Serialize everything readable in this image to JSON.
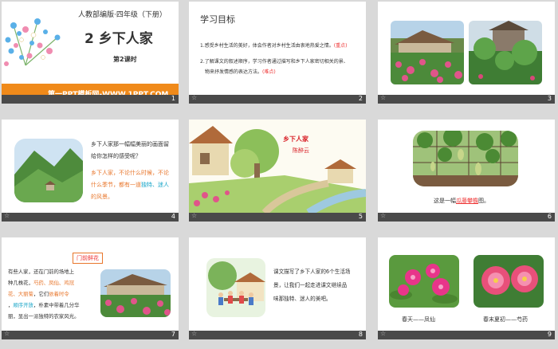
{
  "slides": [
    {
      "num": "1",
      "publisher": "人教部编版·四年级（下册）",
      "lesson_title": "2 乡下人家",
      "period": "第2课时",
      "footer": "第一PPT模板网-WWW.1PPT.COM"
    },
    {
      "num": "2",
      "heading": "学习目标",
      "goal1": "1.感受乡村生活的美好，体会作者对乡村生活由衷地热爱之情。",
      "goal1_tag": "(重点)",
      "goal2a": "2.了解课文的叙述顺序，学习作者通过描写和乡下人家密切相关的景、",
      "goal2b": "物来抒发情感的表达方法。",
      "goal2_tag": "(难点)"
    },
    {
      "num": "3"
    },
    {
      "num": "4",
      "question_a": "乡下人家那一幅幅美丽的画面留",
      "question_b": "给你怎样的感受呢？",
      "answer_a": "乡下人家，不论什么时候，不论",
      "answer_b1": "什么季节，都有一道",
      "answer_b2": "独特、迷人",
      "answer_c": "的风景。"
    },
    {
      "num": "5",
      "title": "乡下人家",
      "author": "陈醉云"
    },
    {
      "num": "6",
      "caption_a": "这是一幅",
      "caption_blank": "瓜藤攀檐",
      "caption_b": "图。"
    },
    {
      "num": "7",
      "tag": "门前鲜花",
      "line1": "有些人家，还在门前的场地上",
      "line2_a": "种几株花，",
      "line2_b": "芍药、凤仙、鸡冠",
      "line3_a": "花、大丽菊",
      "line3_b": "，它们",
      "line3_c": "依着时令",
      "line4_a": "，",
      "line4_b": "顺序开放",
      "line4_c": "，朴素中带着几分华",
      "line5": "丽，显出一派独特的农家风光。"
    },
    {
      "num": "8",
      "text_a": "课文描写了乡下人家的6个生活场",
      "text_b": "景，让我们一起走进课文继续品",
      "text_c": "味那独特、迷人的美吧。"
    },
    {
      "num": "9",
      "cap_left": "春天——凤仙",
      "cap_right": "春末夏初——芍药"
    }
  ],
  "colors": {
    "orange": "#e8762b",
    "red": "#e33333",
    "cyan": "#1aa6c8",
    "pink": "#e4006f",
    "bar": "#4a4a4a"
  }
}
